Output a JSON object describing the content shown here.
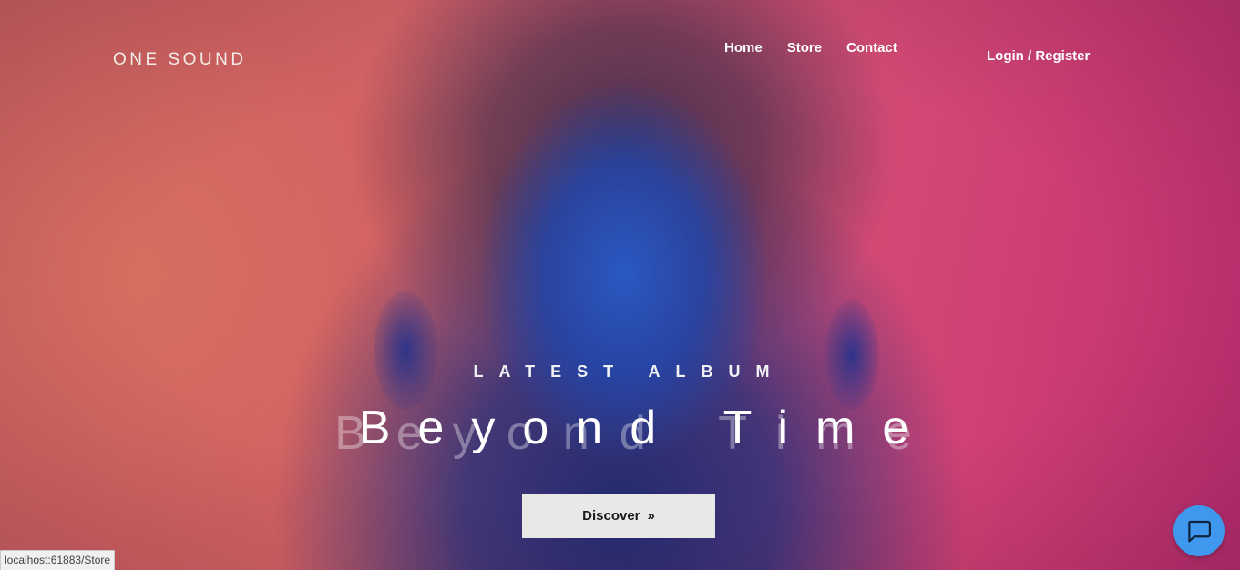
{
  "brand": {
    "name": "ONE SOUND"
  },
  "nav": {
    "items": [
      {
        "label": "Home"
      },
      {
        "label": "Store"
      },
      {
        "label": "Contact"
      }
    ],
    "auth_label": "Login / Register"
  },
  "hero": {
    "eyebrow": "LATEST ALBUM",
    "title": "Beyond Time",
    "button_label": "Discover",
    "button_icon": "double-chevron-right-icon",
    "colors": {
      "accent_left": "#d86b6b",
      "accent_right": "#cf3f75",
      "face_blue": "#2d5ac8",
      "button_bg": "#e8e8e6"
    }
  },
  "chat": {
    "icon": "chat-bubble-icon",
    "color": "#3f98ee"
  },
  "browser": {
    "status_url": "localhost:61883/Store"
  }
}
